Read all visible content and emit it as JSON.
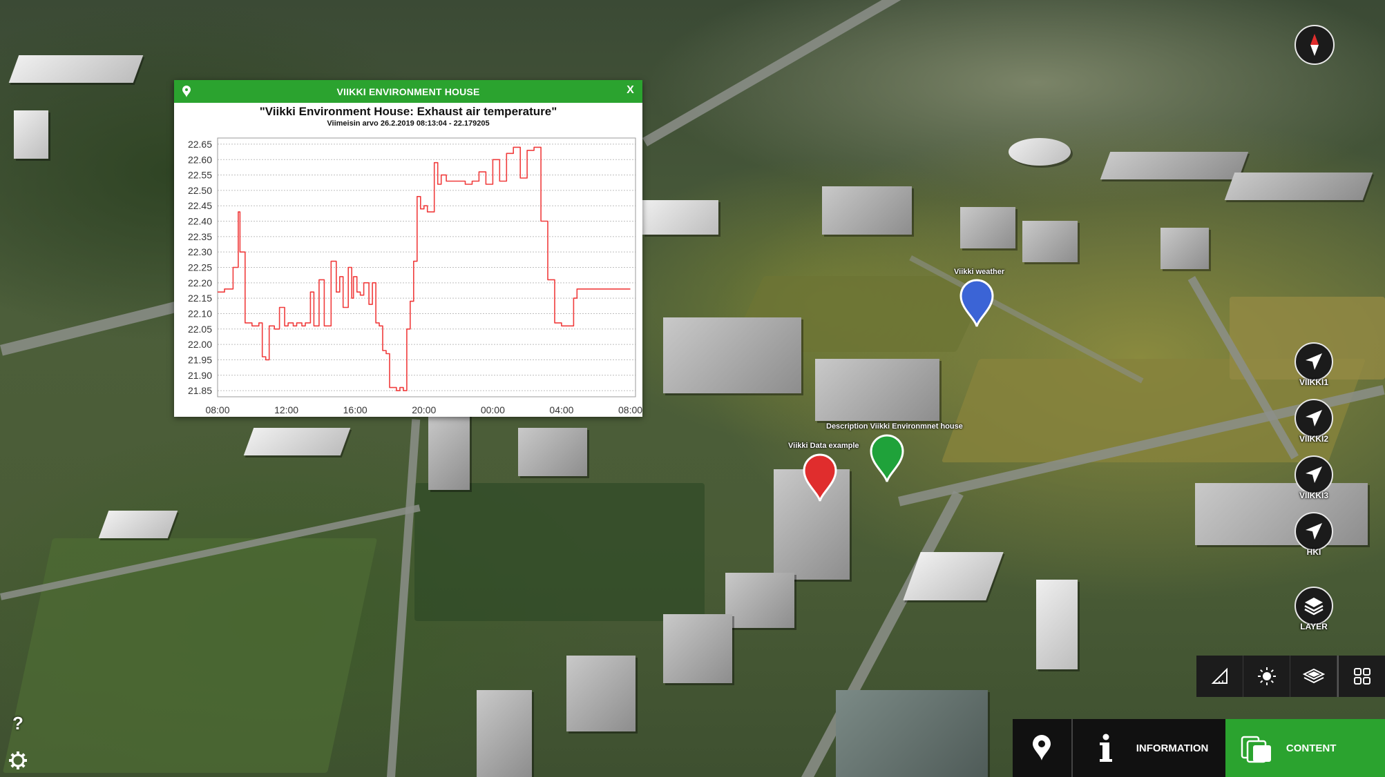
{
  "popup": {
    "title": "VIIKKI ENVIRONMENT HOUSE",
    "close_label": "X"
  },
  "chart_data": {
    "type": "line",
    "title": "\"Viikki Environment House: Exhaust air temperature\"",
    "subtitle": "Viimeisin arvo 26.2.2019 08:13:04 - 22.179205",
    "xlabel": "",
    "ylabel": "",
    "x_ticks": [
      "08:00",
      "12:00",
      "16:00",
      "20:00",
      "00:00",
      "04:00",
      "08:00"
    ],
    "x_range": [
      0,
      24.3
    ],
    "y_ticks": [
      21.85,
      21.9,
      21.95,
      22.0,
      22.05,
      22.1,
      22.15,
      22.2,
      22.25,
      22.3,
      22.35,
      22.4,
      22.45,
      22.5,
      22.55,
      22.6,
      22.65
    ],
    "ylim": [
      21.83,
      22.67
    ],
    "grid": true,
    "line_color": "#f03c3c",
    "series": [
      {
        "x": [
          0,
          0.4,
          0.9,
          1.2,
          1.3,
          1.6,
          1.8,
          2.0,
          2.4,
          2.6,
          2.8,
          3.0,
          3.3,
          3.6,
          3.9,
          4.1,
          4.4,
          4.6,
          4.9,
          5.1,
          5.4,
          5.6,
          5.9,
          6.2,
          6.6,
          6.9,
          7.1,
          7.3,
          7.6,
          7.8,
          7.9,
          8.1,
          8.3,
          8.5,
          8.8,
          9.0,
          9.2,
          9.4,
          9.6,
          9.8,
          10.0,
          10.2,
          10.4,
          10.6,
          10.8,
          11.0,
          11.2,
          11.4,
          11.6,
          11.8,
          12.0,
          12.2,
          12.4,
          12.6,
          12.8,
          13.0,
          13.3,
          13.6,
          14.0,
          14.4,
          14.8,
          15.2,
          15.6,
          16.0,
          16.4,
          16.8,
          17.2,
          17.6,
          18.0,
          18.4,
          18.8,
          19.2,
          19.6,
          20.0,
          20.3,
          20.5,
          20.7,
          20.9,
          21.1,
          21.3,
          21.5,
          21.7,
          22.0,
          22.3,
          22.6,
          22.9,
          23.2,
          23.5,
          24.0
        ],
        "y": [
          22.17,
          22.18,
          22.25,
          22.43,
          22.3,
          22.07,
          22.07,
          22.06,
          22.07,
          21.96,
          21.95,
          22.06,
          22.05,
          22.12,
          22.06,
          22.07,
          22.06,
          22.07,
          22.06,
          22.07,
          22.17,
          22.06,
          22.21,
          22.06,
          22.27,
          22.17,
          22.22,
          22.12,
          22.25,
          22.15,
          22.22,
          22.17,
          22.16,
          22.2,
          22.13,
          22.2,
          22.07,
          22.06,
          21.98,
          21.97,
          21.86,
          21.86,
          21.85,
          21.86,
          21.85,
          22.05,
          22.14,
          22.27,
          22.48,
          22.44,
          22.45,
          22.43,
          22.43,
          22.59,
          22.52,
          22.55,
          22.53,
          22.53,
          22.53,
          22.52,
          22.53,
          22.56,
          22.52,
          22.6,
          22.53,
          22.62,
          22.64,
          22.54,
          22.63,
          22.64,
          22.4,
          22.21,
          22.07,
          22.06,
          22.06,
          22.06,
          22.15,
          22.18,
          22.18,
          22.18,
          22.18,
          22.18,
          22.18,
          22.18,
          22.18,
          22.18,
          22.18,
          22.18,
          22.18
        ]
      }
    ]
  },
  "markers": [
    {
      "label": "Viikki weather",
      "color": "#3b64d6"
    },
    {
      "label": "Viikki Data example",
      "color": "#e02d2d"
    },
    {
      "label": "Description Viikki Environmnet house",
      "color": "#1fa23a"
    }
  ],
  "nav_buttons": [
    {
      "label": "VIIKKI1"
    },
    {
      "label": "VIIKKI2"
    },
    {
      "label": "VIIKKI3"
    },
    {
      "label": "HKI"
    }
  ],
  "layer_button": {
    "label": "LAYER"
  },
  "bottom_bar": {
    "information_label": "INFORMATION",
    "content_label": "CONTENT"
  },
  "help_label": "?"
}
